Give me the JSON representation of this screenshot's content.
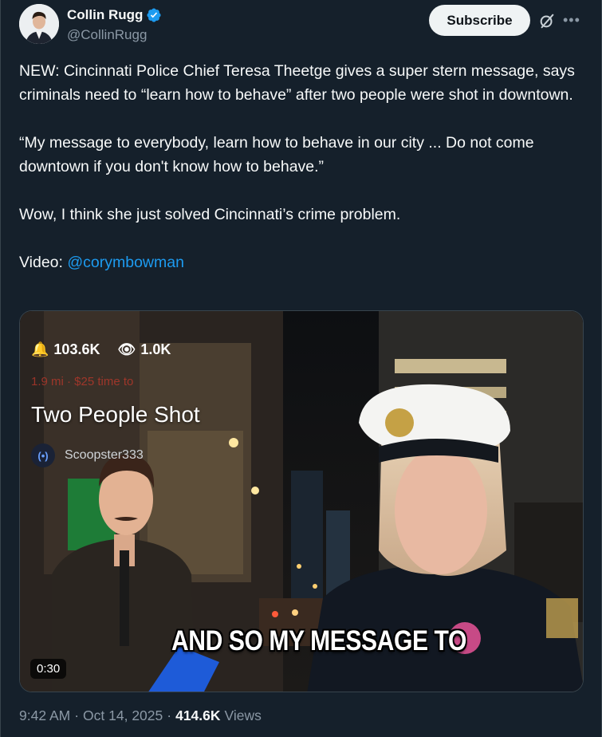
{
  "author": {
    "display_name": "Collin Rugg",
    "handle": "@CollinRugg",
    "verified": true
  },
  "header": {
    "subscribe_label": "Subscribe",
    "grok_icon": "grok-icon",
    "more_icon": "more-icon"
  },
  "tweet": {
    "paragraph1": "NEW: Cincinnati Police Chief Teresa Theetge gives a super stern message, says criminals need to “learn how to behave” after two people were shot in downtown.",
    "paragraph2": "“My message to everybody, learn how to behave in our city ... Do not come downtown if you don't know how to behave.”",
    "paragraph3": "Wow, I think she just solved Cincinnati’s crime problem.",
    "video_prefix": "Video: ",
    "video_mention": "@corymbowman"
  },
  "media": {
    "likes": "103.6K",
    "views_overlay": "1.0K",
    "faint_line": "1.9 mi · $25 time to",
    "title": "Two People Shot",
    "source_name": "Scoopster333",
    "caption": "AND SO MY MESSAGE TO",
    "duration": "0:30"
  },
  "meta": {
    "time": "9:42 AM",
    "date": "Oct 14, 2025",
    "views": "414.6K",
    "views_label": "Views"
  },
  "colors": {
    "background": "#15202b",
    "text": "#f7f9f9",
    "secondary": "#8b98a5",
    "accent": "#1d9bf0",
    "verified": "#1d9bf0"
  }
}
